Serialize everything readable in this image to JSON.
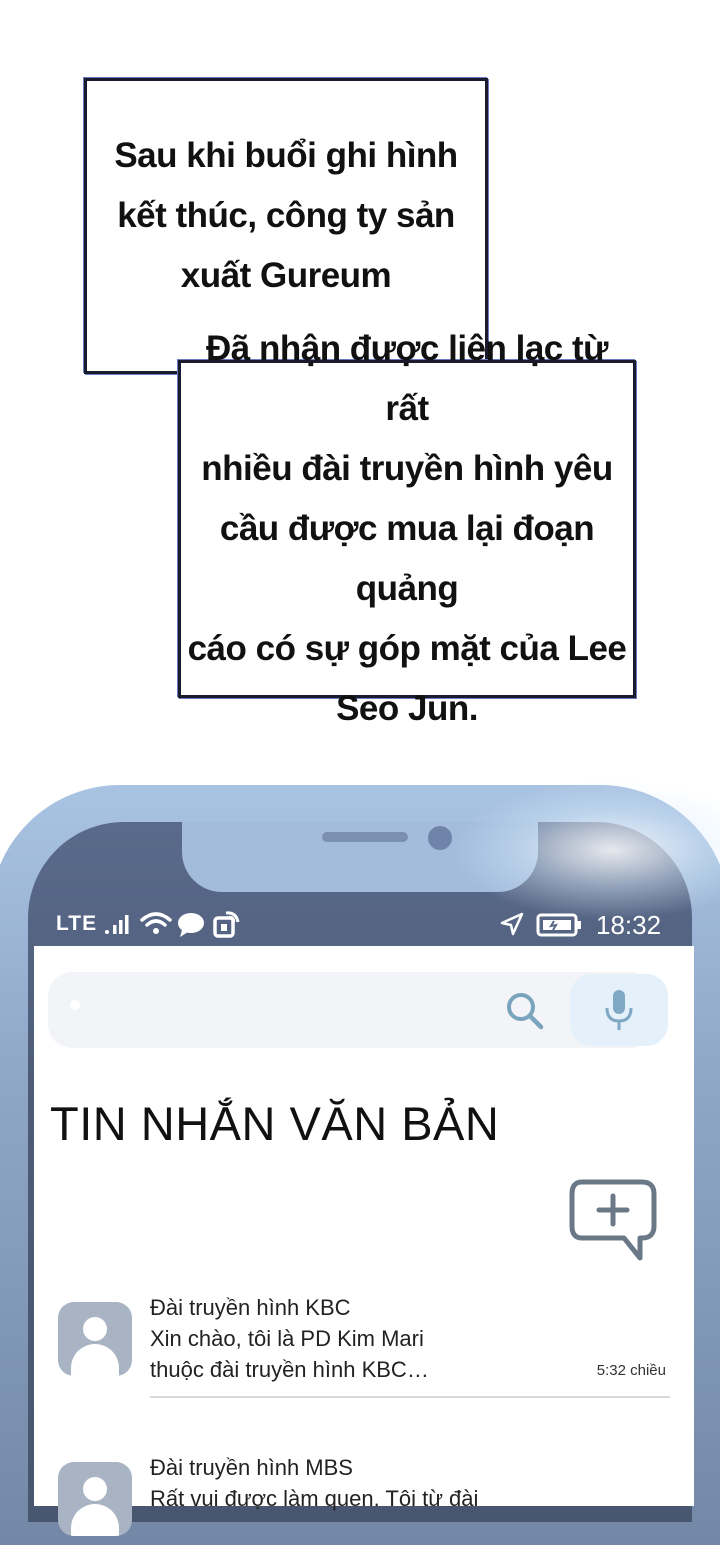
{
  "narration": {
    "box1": "Sau khi buổi ghi hình\nkết thúc, công ty sản\nxuất Gureum",
    "box2": "Đã nhận được liên lạc từ rất\nnhiều đài truyền hình yêu\ncầu được mua lại đoạn quảng\ncáo có sự góp mặt của Lee\nSeo Jun."
  },
  "status_bar": {
    "network": "LTE",
    "time": "18:32",
    "icons": [
      "signal-icon",
      "wifi-icon",
      "chat-icon",
      "sync-icon",
      "navigation-icon",
      "battery-icon"
    ]
  },
  "search": {
    "icons": [
      "search-icon",
      "microphone-icon"
    ]
  },
  "page": {
    "title": "TIN NHẮN VĂN BẢN",
    "compose_icon": "compose-message-icon"
  },
  "messages": [
    {
      "sender": "Đài truyền hình KBC",
      "line1": "Xin chào, tôi là PD Kim Mari",
      "line2": "thuộc đài truyền hình KBC…",
      "time": "5:32 chiều"
    },
    {
      "sender": "Đài truyền hình MBS",
      "line1": "Rất vui được làm quen. Tôi từ đài",
      "line2": "",
      "time": ""
    }
  ],
  "colors": {
    "phone_frame": "#8ea6c6",
    "bezel": "#4d5b78",
    "icon_blue": "#6f8fb0",
    "avatar": "#a8b4c4"
  }
}
